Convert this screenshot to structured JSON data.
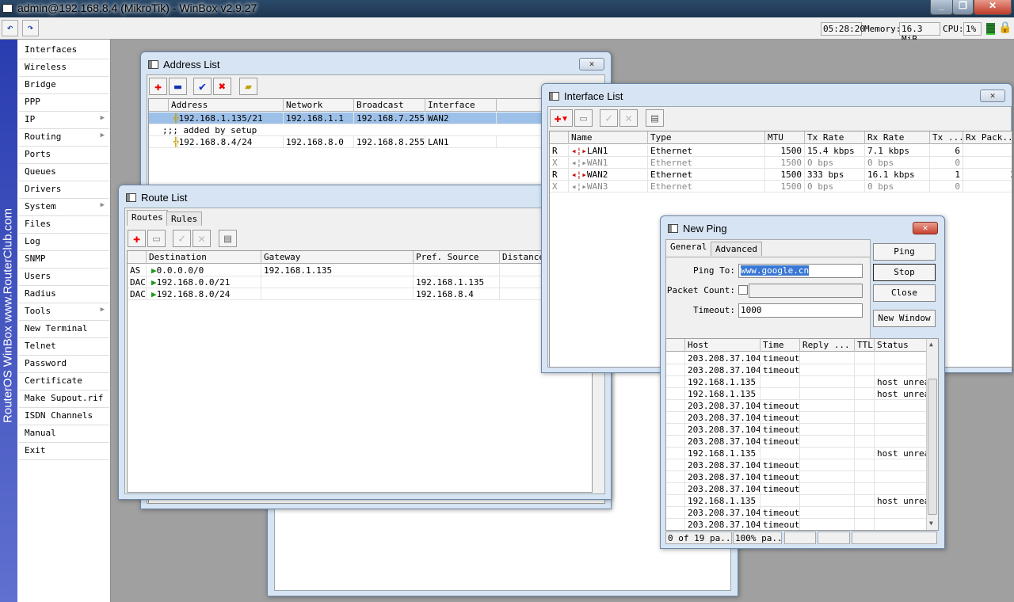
{
  "app": {
    "title": "admin@192.168.8.4 (MikroTik) - WinBox v2.9.27"
  },
  "toolbar": {
    "undo": "↶",
    "redo": "↷",
    "time": "05:28:20",
    "memory_label": "Memory:",
    "memory": "16.3 MiB",
    "cpu_label": "CPU:",
    "cpu": "1%",
    "secure_icon": "lock-icon"
  },
  "brand": "RouterOS WinBox   www.RouterClub.com",
  "menu": [
    {
      "label": "Interfaces"
    },
    {
      "label": "Wireless"
    },
    {
      "label": "Bridge"
    },
    {
      "label": "PPP"
    },
    {
      "label": "IP",
      "sub": true
    },
    {
      "label": "Routing",
      "sub": true
    },
    {
      "label": "Ports"
    },
    {
      "label": "Queues"
    },
    {
      "label": "Drivers"
    },
    {
      "label": "System",
      "sub": true
    },
    {
      "label": "Files"
    },
    {
      "label": "Log"
    },
    {
      "label": "SNMP"
    },
    {
      "label": "Users"
    },
    {
      "label": "Radius"
    },
    {
      "label": "Tools",
      "sub": true
    },
    {
      "label": "New Terminal"
    },
    {
      "label": "Telnet"
    },
    {
      "label": "Password"
    },
    {
      "label": "Certificate"
    },
    {
      "label": "Make Supout.rif"
    },
    {
      "label": "ISDN Channels"
    },
    {
      "label": "Manual"
    },
    {
      "label": "Exit"
    }
  ],
  "address_list": {
    "title": "Address List",
    "columns": [
      "Address",
      "Network",
      "Broadcast",
      "Interface"
    ],
    "rows": [
      {
        "address": "192.168.1.135/21",
        "network": "192.168.1.1",
        "broadcast": "192.168.7.255",
        "interface": "WAN2",
        "selected": true
      },
      {
        "comment": ";;; added by setup"
      },
      {
        "address": "192.168.8.4/24",
        "network": "192.168.8.0",
        "broadcast": "192.168.8.255",
        "interface": "LAN1"
      }
    ]
  },
  "route_list": {
    "title": "Route List",
    "tabs": [
      "Routes",
      "Rules"
    ],
    "columns": [
      "Destination",
      "Gateway",
      "Pref. Source",
      "Distance"
    ],
    "rows": [
      {
        "flags": "AS",
        "destination": "0.0.0.0/0",
        "gateway": "192.168.1.135",
        "pref_source": ""
      },
      {
        "flags": "DAC",
        "destination": "192.168.0.0/21",
        "gateway": "",
        "pref_source": "192.168.1.135"
      },
      {
        "flags": "DAC",
        "destination": "192.168.8.0/24",
        "gateway": "",
        "pref_source": "192.168.8.4"
      }
    ]
  },
  "interface_list": {
    "title": "Interface List",
    "columns": [
      "Name",
      "Type",
      "MTU",
      "Tx Rate",
      "Rx Rate",
      "Tx ...",
      "Rx Pack..."
    ],
    "rows": [
      {
        "flag": "R",
        "name": "LAN1",
        "type": "Ethernet",
        "mtu": "1500",
        "tx": "15.4 kbps",
        "rx": "7.1 kbps",
        "txp": "6",
        "rxp": "",
        "disabled": false
      },
      {
        "flag": "X",
        "name": "WAN1",
        "type": "Ethernet",
        "mtu": "1500",
        "tx": "0 bps",
        "rx": "0 bps",
        "txp": "0",
        "rxp": "",
        "disabled": true
      },
      {
        "flag": "R",
        "name": "WAN2",
        "type": "Ethernet",
        "mtu": "1500",
        "tx": "333 bps",
        "rx": "16.1 kbps",
        "txp": "1",
        "rxp": "3",
        "disabled": false
      },
      {
        "flag": "X",
        "name": "WAN3",
        "type": "Ethernet",
        "mtu": "1500",
        "tx": "0 bps",
        "rx": "0 bps",
        "txp": "0",
        "rxp": "",
        "disabled": true
      }
    ]
  },
  "ping": {
    "title": "New Ping",
    "tabs": [
      "General",
      "Advanced"
    ],
    "ping_to_label": "Ping To:",
    "ping_to": "www.google.cn",
    "packet_count_label": "Packet Count:",
    "packet_count": "",
    "timeout_label": "Timeout:",
    "timeout": "1000",
    "buttons": [
      "Ping",
      "Stop",
      "Close",
      "New Window"
    ],
    "columns": [
      "Host",
      "Time",
      "Reply ...",
      "TTL",
      "Status"
    ],
    "rows": [
      [
        "203.208.37.104",
        "timeout",
        ""
      ],
      [
        "203.208.37.104",
        "timeout",
        ""
      ],
      [
        "192.168.1.135",
        "",
        "host unrea"
      ],
      [
        "192.168.1.135",
        "",
        "host unrea"
      ],
      [
        "203.208.37.104",
        "timeout",
        ""
      ],
      [
        "203.208.37.104",
        "timeout",
        ""
      ],
      [
        "203.208.37.104",
        "timeout",
        ""
      ],
      [
        "203.208.37.104",
        "timeout",
        ""
      ],
      [
        "192.168.1.135",
        "",
        "host unrea"
      ],
      [
        "203.208.37.104",
        "timeout",
        ""
      ],
      [
        "203.208.37.104",
        "timeout",
        ""
      ],
      [
        "203.208.37.104",
        "timeout",
        ""
      ],
      [
        "192.168.1.135",
        "",
        "host unrea"
      ],
      [
        "203.208.37.104",
        "timeout",
        ""
      ],
      [
        "203.208.37.104",
        "timeout",
        ""
      ]
    ],
    "status": [
      "0 of 19 pa...",
      "100% pa...",
      "",
      "",
      ""
    ]
  }
}
